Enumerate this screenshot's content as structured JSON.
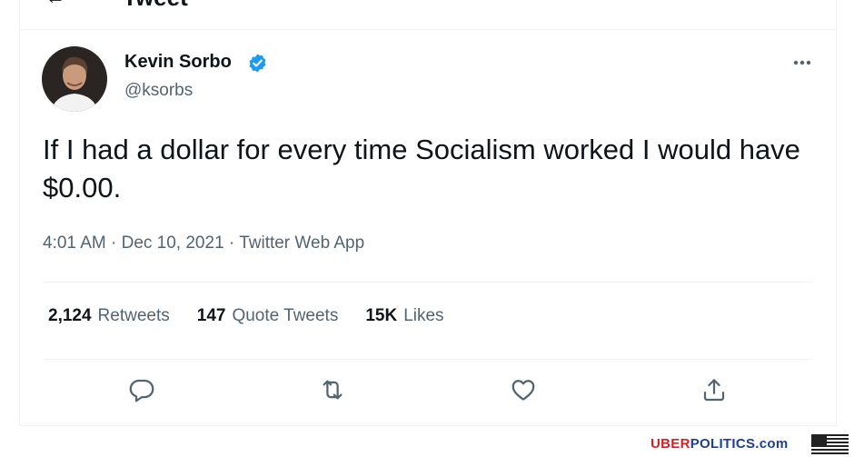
{
  "header": {
    "title": "Tweet",
    "back_icon": "arrow-left-icon"
  },
  "author": {
    "display_name": "Kevin Sorbo",
    "handle": "@ksorbs",
    "verified": true,
    "verified_icon": "verified-badge-icon",
    "verified_color": "#1d9bf0"
  },
  "more_icon": "more-horizontal-icon",
  "tweet": {
    "text": "If I had a dollar for every time Socialism worked I would have $0.00.",
    "time": "4:01 AM",
    "separator": " · ",
    "date": "Dec 10, 2021",
    "source": "Twitter Web App"
  },
  "stats": [
    {
      "count": "2,124",
      "label": "Retweets"
    },
    {
      "count": "147",
      "label": "Quote Tweets"
    },
    {
      "count": "15K",
      "label": "Likes"
    }
  ],
  "actions": [
    {
      "name": "reply",
      "icon": "reply-icon"
    },
    {
      "name": "retweet",
      "icon": "retweet-icon"
    },
    {
      "name": "like",
      "icon": "heart-icon"
    },
    {
      "name": "share",
      "icon": "share-icon"
    }
  ],
  "watermark": {
    "part1": "UBER",
    "part2": "POLITICS",
    "part3": ".com"
  },
  "colors": {
    "text_primary": "#0f1419",
    "text_secondary": "#536471",
    "border": "#eff3f4",
    "watermark_red": "#d31f26",
    "watermark_blue": "#1f3f8f"
  }
}
